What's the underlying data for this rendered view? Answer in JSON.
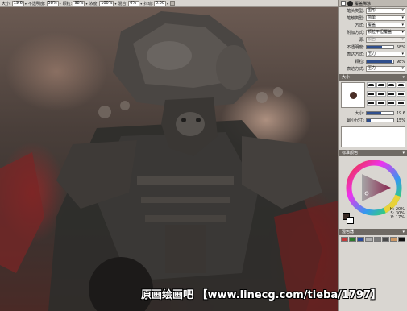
{
  "toolbar": {
    "items": [
      {
        "label": "大小:",
        "value": "19.6"
      },
      {
        "label": "不透明度:",
        "value": "58%"
      },
      {
        "label": "颗粒:",
        "value": "98%"
      },
      {
        "label": "浓度:",
        "value": "100%"
      },
      {
        "label": "混合:",
        "value": "0%"
      },
      {
        "label": "抖动:",
        "value": "0.00"
      }
    ]
  },
  "panel": {
    "header": {
      "title": "覆盖稀涂"
    },
    "properties": [
      {
        "label": "笔头类型:",
        "value": "图形",
        "enabled": true
      },
      {
        "label": "笔触类型:",
        "value": "简单",
        "enabled": true
      },
      {
        "label": "方式:",
        "value": "覆盖",
        "enabled": true
      },
      {
        "label": "附加方式:",
        "value": "颗粒平坦覆盖",
        "enabled": true
      },
      {
        "label": "源:",
        "value": "颜色",
        "enabled": false
      }
    ],
    "opacity": {
      "label": "不透明度:",
      "value": "58%",
      "fraction": 0.58
    },
    "opacity_expr": {
      "label": "表达方式:",
      "value": "压力"
    },
    "grain": {
      "label": "颗粒:",
      "value": "98%",
      "fraction": 0.98
    },
    "grain_expr": {
      "label": "表达方式:",
      "value": "压力"
    },
    "size_section": {
      "title": "大小"
    },
    "size": {
      "label": "大小:",
      "value": "19.6",
      "fraction": 0.55
    },
    "min_size": {
      "label": "最小尺寸:",
      "value": "15%",
      "fraction": 0.15
    },
    "color_section": {
      "title": "标准颜色"
    },
    "hsv": {
      "h": "H: 20%",
      "s": "S: 30%",
      "v": "V: 17%"
    },
    "palette_section": {
      "title": "混色器"
    },
    "palette_colors": [
      "#c43a3a",
      "#2d7a2d",
      "#2a4a9a",
      "#b0b0b0",
      "#7a7a7a",
      "#4a4a4a",
      "#cc9966",
      "#111111"
    ]
  },
  "watermark": "原画绘画吧 【www.linecg.com/tieba/1797】",
  "colors": {
    "fg": "#3a2a25",
    "accent": "#2f4e8c"
  }
}
